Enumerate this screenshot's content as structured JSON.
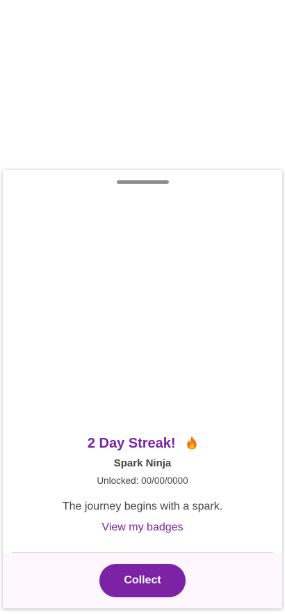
{
  "sheet": {
    "title": "2 Day Streak!",
    "title_icon": "flame-icon",
    "badge_name": "Spark Ninja",
    "unlocked_text": "Unlocked: 00/00/0000",
    "message": "The journey begins with a spark.",
    "view_badges_label": "View my badges",
    "collect_label": "Collect"
  },
  "colors": {
    "accent": "#7b22a5",
    "text": "#444444",
    "footer_bg": "#fdf6fd",
    "handle": "#8c8c8c"
  }
}
